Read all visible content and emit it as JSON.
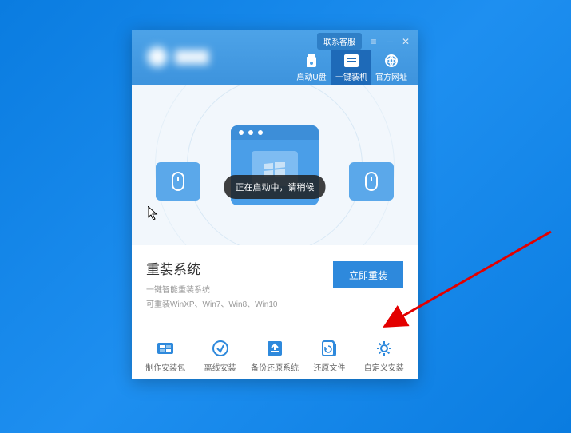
{
  "titlebar": {
    "contact": "联系客服"
  },
  "nav": {
    "usb": "启动U盘",
    "onekey": "一键装机",
    "website": "官方网址"
  },
  "toast": "正在启动中，请稍候",
  "main": {
    "title": "重装系统",
    "sub1": "一键智能重装系统",
    "sub2": "可重装WinXP、Win7、Win8、Win10",
    "button": "立即重装"
  },
  "tools": {
    "pkg": "制作安装包",
    "offline": "离线安装",
    "backup": "备份还原系统",
    "restore": "还原文件",
    "custom": "自定义安装"
  }
}
